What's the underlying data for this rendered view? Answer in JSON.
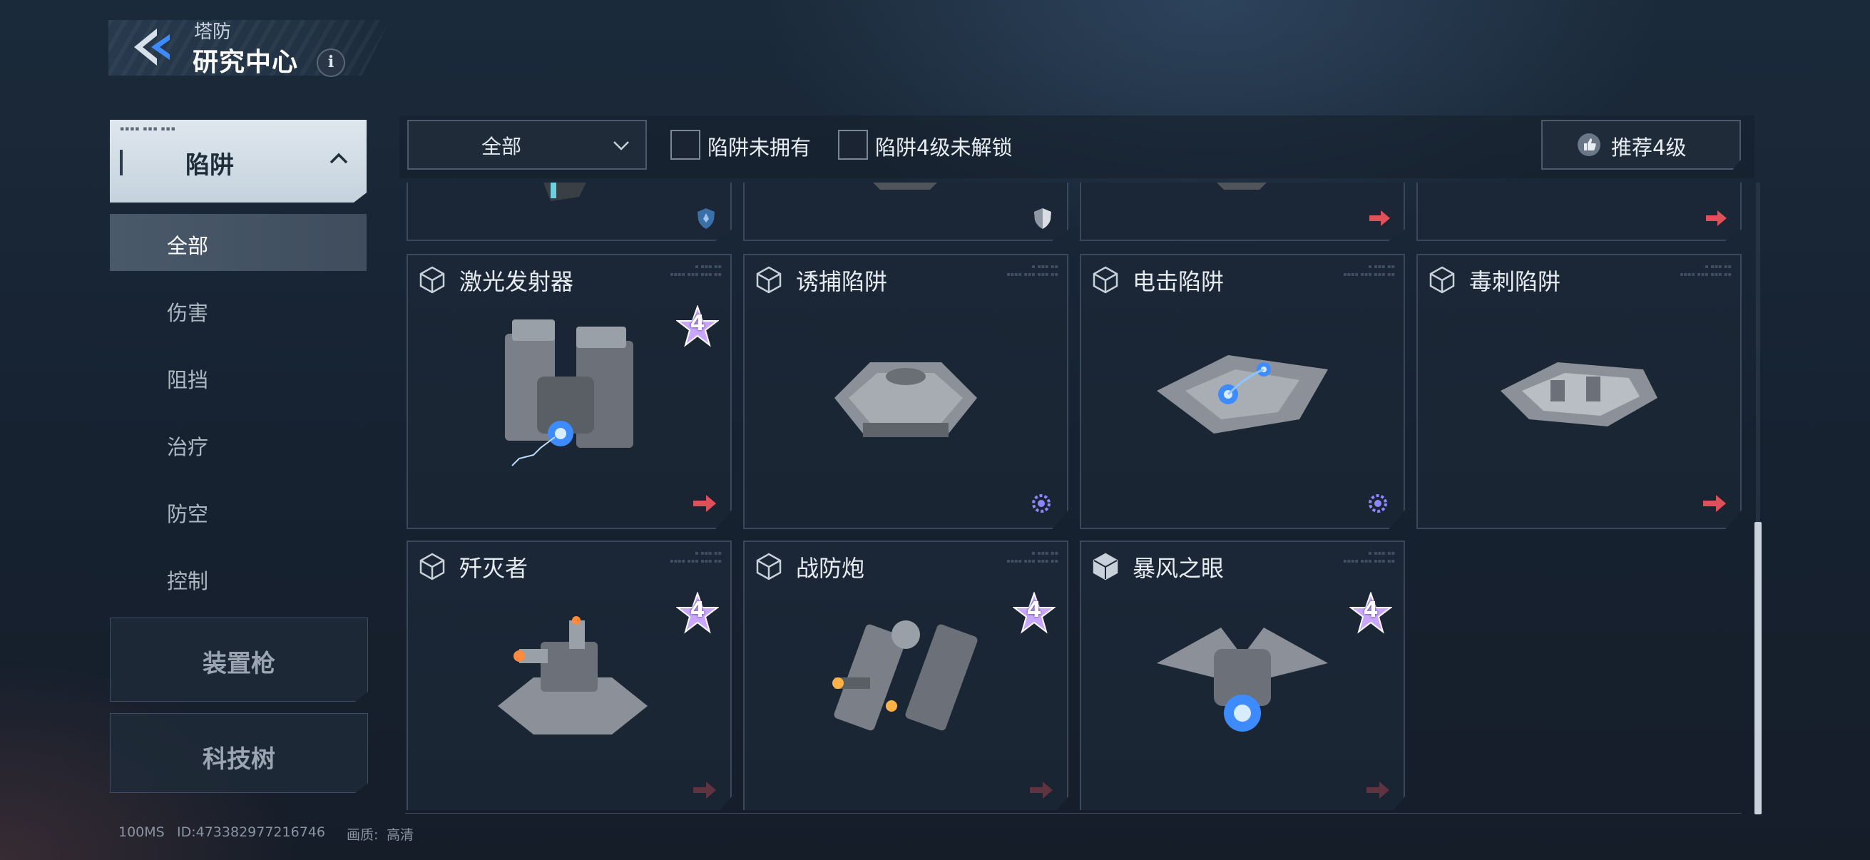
{
  "header": {
    "subtitle": "塔防",
    "title": "研究中心",
    "info_label": "i"
  },
  "sidebar": {
    "active_category": {
      "label": "陷阱",
      "tiny_tag": "▪▪▪▪ ▪▪▪ ▪▪▪"
    },
    "sub_items": [
      "全部",
      "伤害",
      "阻挡",
      "治疗",
      "防空",
      "控制"
    ],
    "other_categories": [
      "装置枪",
      "科技树"
    ]
  },
  "filters": {
    "dropdown_value": "全部",
    "checkbox_not_owned": "陷阱未拥有",
    "checkbox_lv4_locked": "陷阱4级未解锁",
    "recommend_label": "推荐4级"
  },
  "cards": [
    {
      "name": "激光发射器",
      "level": "4",
      "corner_icon": "red-arrow-icon"
    },
    {
      "name": "诱捕陷阱",
      "level": "",
      "corner_icon": "gear-icon"
    },
    {
      "name": "电击陷阱",
      "level": "",
      "corner_icon": "gear-icon"
    },
    {
      "name": "毒刺陷阱",
      "level": "",
      "corner_icon": "red-arrow-icon"
    },
    {
      "name": "歼灭者",
      "level": "4",
      "corner_icon": "red-arrow-icon"
    },
    {
      "name": "战防炮",
      "level": "4",
      "corner_icon": "red-arrow-icon"
    },
    {
      "name": "暴风之眼",
      "level": "4",
      "corner_icon": "red-arrow-icon"
    }
  ],
  "partial_top_row_icons": [
    "shield-blue-icon",
    "shield-white-icon",
    "red-arrow-icon",
    "red-arrow-icon"
  ],
  "status_bar": {
    "ping": "100MS",
    "id": "ID:473382977216746",
    "quality_label": "画质:",
    "quality_value": "高清"
  },
  "colors": {
    "accent_blue": "#3d8bff",
    "arrow_red": "#e0505a",
    "gear_purple": "#8f86ff",
    "level_star": "#c9a6ff"
  }
}
